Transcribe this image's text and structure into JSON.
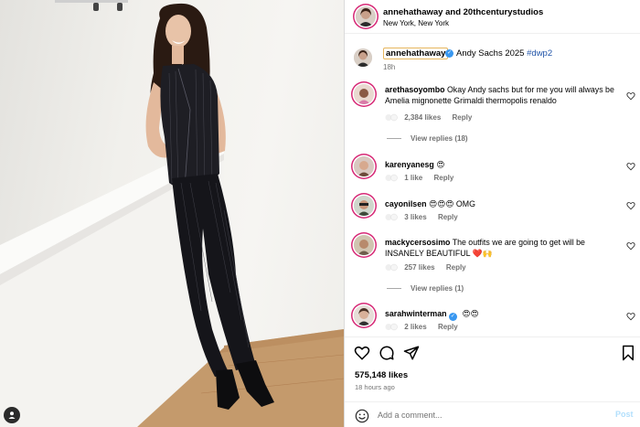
{
  "post": {
    "header": {
      "title": "annehathaway and 20thcenturystudios",
      "location": "New York, New York"
    },
    "caption": {
      "username": "annehathaway",
      "text": "Andy Sachs 2025",
      "hashtag": "#dwp2",
      "time": "18h"
    },
    "comments": [
      {
        "username": "arethasoyombo",
        "text": "Okay Andy sachs but for me you will always be Amelia mignonette Grimaldi thermopolis renaldo",
        "likes": "2,384 likes",
        "reply": "Reply",
        "view_replies": "View replies (18)"
      },
      {
        "username": "karenyanesg",
        "text": "😍",
        "likes": "1 like",
        "reply": "Reply"
      },
      {
        "username": "cayonilsen",
        "text": "😍😍😍 OMG",
        "likes": "3 likes",
        "reply": "Reply"
      },
      {
        "username": "mackycersosimo",
        "text": "The outfits we are going to get will be INSANELY BEAUTIFUL ❤️🙌",
        "likes": "257 likes",
        "reply": "Reply",
        "view_replies": "View replies (1)"
      },
      {
        "username": "sarahwinterman",
        "text": "😍😍",
        "likes": "2 likes",
        "reply": "Reply"
      }
    ],
    "likes_count": "575,148 likes",
    "time_ago": "18 hours ago",
    "comment_placeholder": "Add a comment...",
    "post_label": "Post"
  },
  "colors": {
    "verified": "#3897f0",
    "hashtag": "#1f53a8",
    "story_ring": "#d62976",
    "post_disabled": "#b2dffc",
    "meta_gray": "#737373"
  },
  "icons": [
    "heart-icon",
    "comment-icon",
    "share-icon",
    "bookmark-icon",
    "emoji-icon",
    "user-tag-icon",
    "verified-icon"
  ]
}
